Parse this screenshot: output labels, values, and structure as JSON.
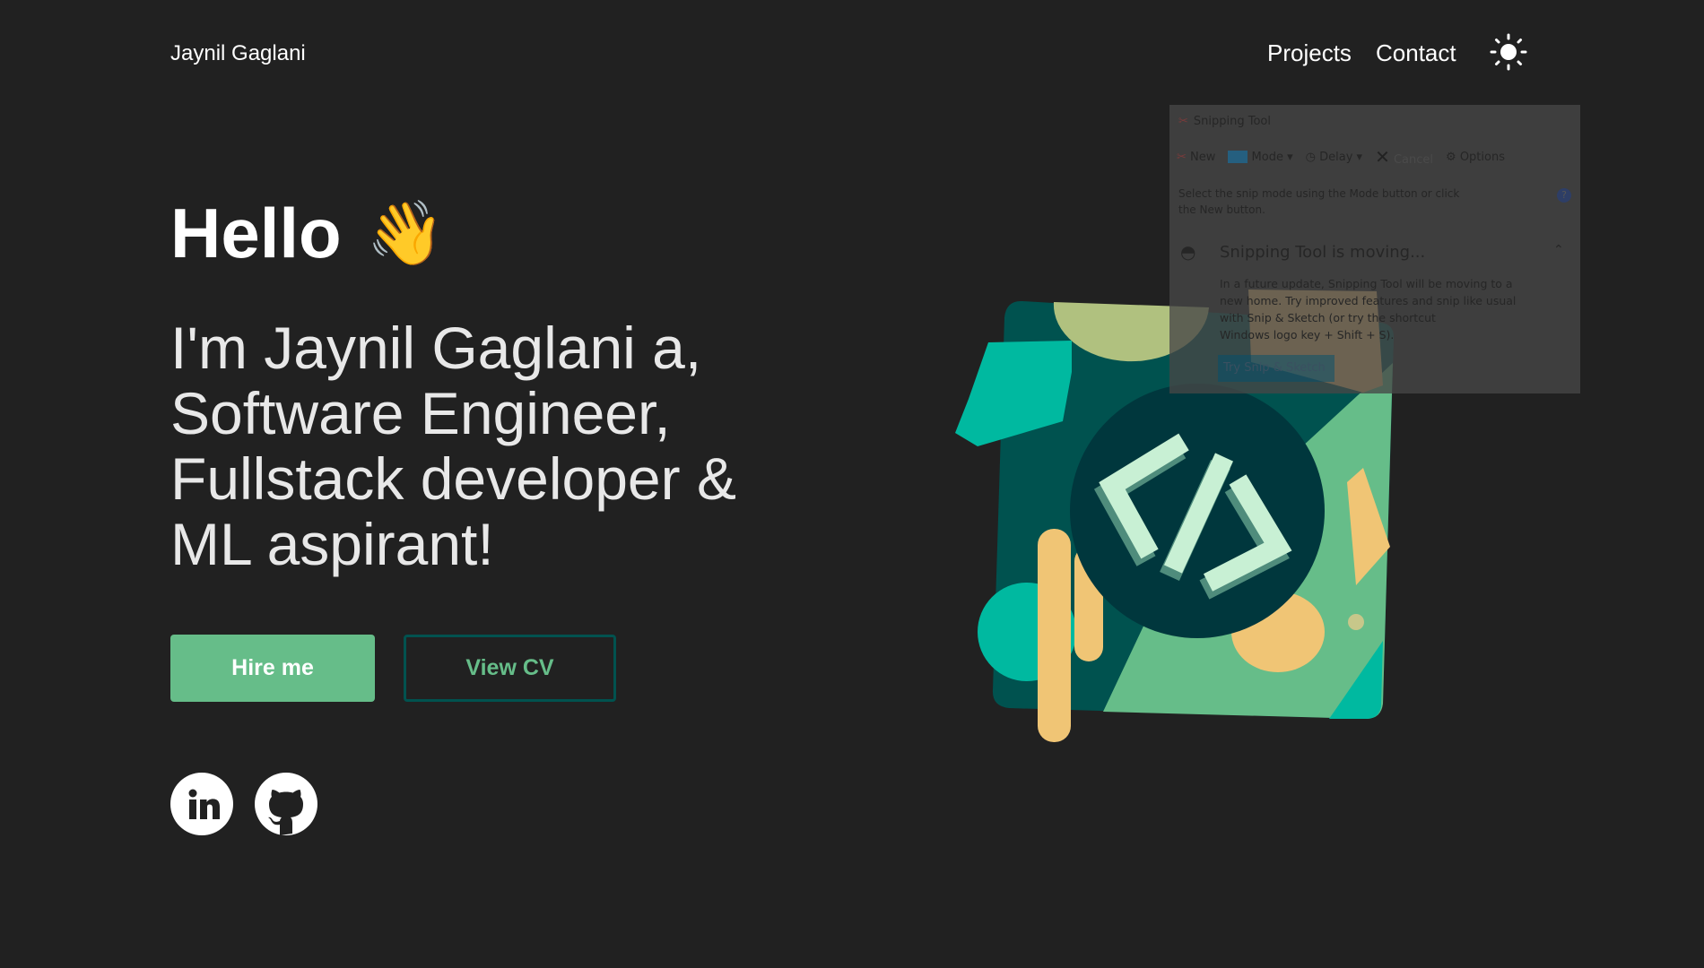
{
  "header": {
    "brand": "Jaynil Gaglani",
    "nav": [
      "Projects",
      "Contact"
    ],
    "theme_icon": "sun-icon"
  },
  "hero": {
    "greeting": "Hello",
    "greeting_emoji": "👋",
    "intro_lines": [
      "I'm Jaynil Gaglani a,",
      "Software Engineer,",
      "Fullstack developer &",
      "ML aspirant!"
    ],
    "hire_label": "Hire me",
    "cv_label": "View CV",
    "socials": [
      "linkedin-icon",
      "github-icon"
    ]
  },
  "snipping_tool": {
    "title": "Snipping Tool",
    "toolbar": [
      "New",
      "Mode",
      "Delay",
      "Cancel",
      "Options"
    ],
    "instruction": "Select the snip mode using the Mode button or click the New button.",
    "notice_title": "Snipping Tool is moving...",
    "notice_lines": [
      "In a future update, Snipping Tool will be moving to a",
      "new home. Try improved features and snip like usual",
      "with Snip & Sketch (or try the shortcut",
      "Windows logo key + Shift + S)."
    ],
    "try_button": "Try Snip & Sketch"
  },
  "colors": {
    "accent": "#66bd89",
    "dark_teal": "#00524f",
    "background": "#212121"
  }
}
